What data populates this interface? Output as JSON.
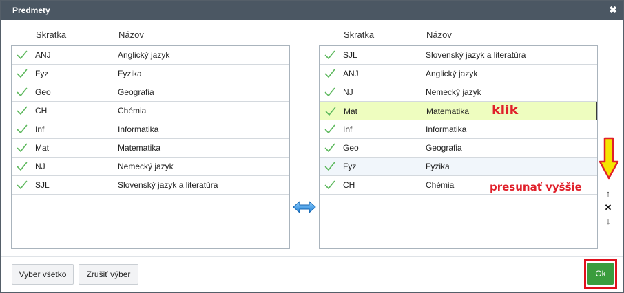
{
  "dialog": {
    "title": "Predmety",
    "close_icon": "close-icon"
  },
  "left_panel": {
    "headers": {
      "abbr": "Skratka",
      "name": "Názov"
    },
    "rows": [
      {
        "abbr": "ANJ",
        "name": "Anglický jazyk"
      },
      {
        "abbr": "Fyz",
        "name": "Fyzika"
      },
      {
        "abbr": "Geo",
        "name": "Geografia"
      },
      {
        "abbr": "CH",
        "name": "Chémia"
      },
      {
        "abbr": "Inf",
        "name": "Informatika"
      },
      {
        "abbr": "Mat",
        "name": "Matematika"
      },
      {
        "abbr": "NJ",
        "name": "Nemecký jazyk"
      },
      {
        "abbr": "SJL",
        "name": "Slovenský jazyk a literatúra"
      }
    ]
  },
  "right_panel": {
    "headers": {
      "abbr": "Skratka",
      "name": "Názov"
    },
    "rows": [
      {
        "abbr": "SJL",
        "name": "Slovenský jazyk a literatúra"
      },
      {
        "abbr": "ANJ",
        "name": "Anglický jazyk"
      },
      {
        "abbr": "NJ",
        "name": "Nemecký jazyk"
      },
      {
        "abbr": "Mat",
        "name": "Matematika"
      },
      {
        "abbr": "Inf",
        "name": "Informatika"
      },
      {
        "abbr": "Geo",
        "name": "Geografia"
      },
      {
        "abbr": "Fyz",
        "name": "Fyzika"
      },
      {
        "abbr": "CH",
        "name": "Chémia"
      }
    ],
    "selected_row": "Mat"
  },
  "annotations": {
    "click_hint": "klik",
    "move_hint": "presunať vyššie"
  },
  "side_controls": {
    "up": "↑",
    "remove": "✕",
    "down": "↓"
  },
  "footer": {
    "select_all": "Vyber všetko",
    "cancel_selection": "Zrušiť výber",
    "ok": "Ok"
  },
  "colors": {
    "titlebar": "#4b5763",
    "check": "#5cb85c",
    "selected_row": "#eefdbf",
    "ok_button": "#3a9c3d",
    "highlight_red": "#e0101c",
    "arrow_yellow": "#f5e400"
  }
}
